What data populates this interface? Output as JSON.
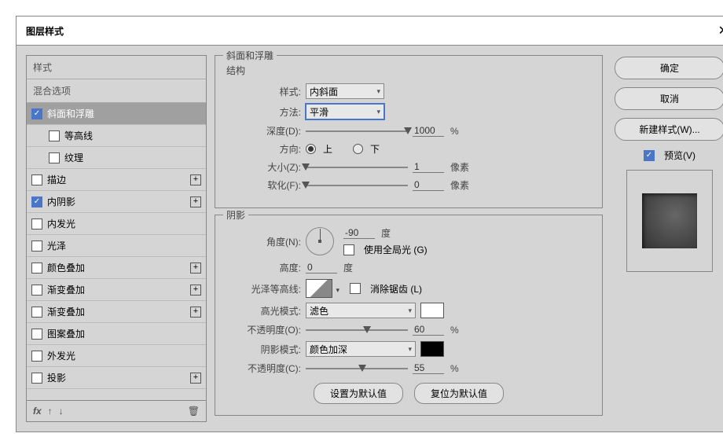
{
  "title": "图层样式",
  "leftPanel": {
    "header": "样式",
    "blendHeader": "混合选项",
    "items": [
      {
        "label": "斜面和浮雕",
        "checked": true,
        "plus": false,
        "indent": false,
        "selected": true
      },
      {
        "label": "等高线",
        "checked": false,
        "plus": false,
        "indent": true
      },
      {
        "label": "纹理",
        "checked": false,
        "plus": false,
        "indent": true
      },
      {
        "label": "描边",
        "checked": false,
        "plus": true,
        "indent": false
      },
      {
        "label": "内阴影",
        "checked": true,
        "plus": true,
        "indent": false
      },
      {
        "label": "内发光",
        "checked": false,
        "plus": false,
        "indent": false
      },
      {
        "label": "光泽",
        "checked": false,
        "plus": false,
        "indent": false
      },
      {
        "label": "颜色叠加",
        "checked": false,
        "plus": true,
        "indent": false
      },
      {
        "label": "渐变叠加",
        "checked": false,
        "plus": true,
        "indent": false
      },
      {
        "label": "渐变叠加",
        "checked": false,
        "plus": true,
        "indent": false
      },
      {
        "label": "图案叠加",
        "checked": false,
        "plus": false,
        "indent": false
      },
      {
        "label": "外发光",
        "checked": false,
        "plus": false,
        "indent": false
      },
      {
        "label": "投影",
        "checked": false,
        "plus": true,
        "indent": false
      }
    ],
    "fxLabel": "fx"
  },
  "center": {
    "groupTitle": "斜面和浮雕",
    "structTitle": "结构",
    "style": {
      "label": "样式:",
      "value": "内斜面"
    },
    "method": {
      "label": "方法:",
      "value": "平滑"
    },
    "depth": {
      "label": "深度(D):",
      "value": "1000",
      "unit": "%",
      "thumb": 100
    },
    "dir": {
      "label": "方向:",
      "up": "上",
      "down": "下",
      "sel": "up"
    },
    "size": {
      "label": "大小(Z):",
      "value": "1",
      "unit": "像素",
      "thumb": 0
    },
    "soften": {
      "label": "软化(F):",
      "value": "0",
      "unit": "像素",
      "thumb": 0
    },
    "shadingTitle": "阴影",
    "angle": {
      "label": "角度(N):",
      "value": "-90",
      "altValue": "0",
      "unit": "度"
    },
    "globalLight": {
      "label": "使用全局光 (G)",
      "checked": false
    },
    "altitude": {
      "label": "高度:",
      "unit": "度"
    },
    "gloss": {
      "label": "光泽等高线:"
    },
    "antialias": {
      "label": "消除锯齿 (L)",
      "checked": false
    },
    "hiMode": {
      "label": "高光模式:",
      "value": "滤色",
      "color": "#ffffff"
    },
    "hiOpacity": {
      "label": "不透明度(O):",
      "value": "60",
      "unit": "%",
      "thumb": 60
    },
    "shMode": {
      "label": "阴影模式:",
      "value": "颜色加深",
      "color": "#000000"
    },
    "shOpacity": {
      "label": "不透明度(C):",
      "value": "55",
      "unit": "%",
      "thumb": 55
    },
    "btnDefault": "设置为默认值",
    "btnReset": "复位为默认值"
  },
  "right": {
    "ok": "确定",
    "cancel": "取消",
    "newStyle": "新建样式(W)...",
    "preview": {
      "label": "预览(V)",
      "checked": true
    }
  }
}
